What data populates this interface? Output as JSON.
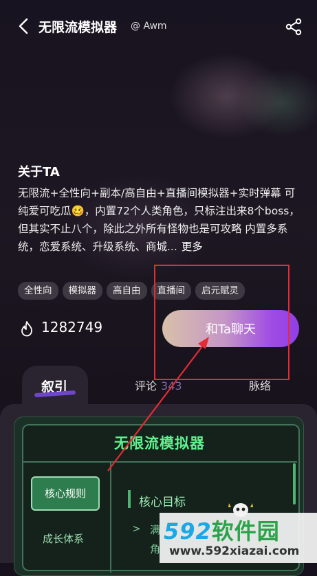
{
  "header": {
    "back_icon": "chevron-left-icon",
    "title": "无限流模拟器",
    "handle": "@ Awm",
    "share_icon": "share-icon"
  },
  "about": {
    "heading": "关于TA",
    "description": "无限流+全性向+副本/高自由+直播间模拟器+实时弹幕 可纯爱可吃瓜🥴，内置72个人类角色，只标注出来8个boss，但其实不止八个，除此之外所有怪物也是可攻略 内置多系统，恋爱系统、升级系统、商城...",
    "more": "更多"
  },
  "tags": [
    "全性向",
    "模拟器",
    "高自由",
    "直播间",
    "启元赋灵"
  ],
  "stats": {
    "fire_icon": "flame-icon",
    "count": "1282749"
  },
  "chat_button": {
    "label": "和Ta聊天"
  },
  "tabs": [
    {
      "label": "叙引",
      "count": ""
    },
    {
      "label": "评论",
      "count": "343"
    },
    {
      "label": "脉络",
      "count": ""
    }
  ],
  "card": {
    "title": "无限流模拟器",
    "nav": [
      "核心规则",
      "成长体系"
    ],
    "section_title": "核心目标",
    "bullet_marker": ">",
    "bullet_line1": "满",
    "bullet_line2": "角"
  },
  "watermark": {
    "brand_num": "592",
    "brand_text": "软件园",
    "url": "www.592xiazai.com"
  },
  "colors": {
    "annotation_red": "#e52b34",
    "accent_green": "#5df38f",
    "chat_gradient_end": "#8f3fe6"
  }
}
